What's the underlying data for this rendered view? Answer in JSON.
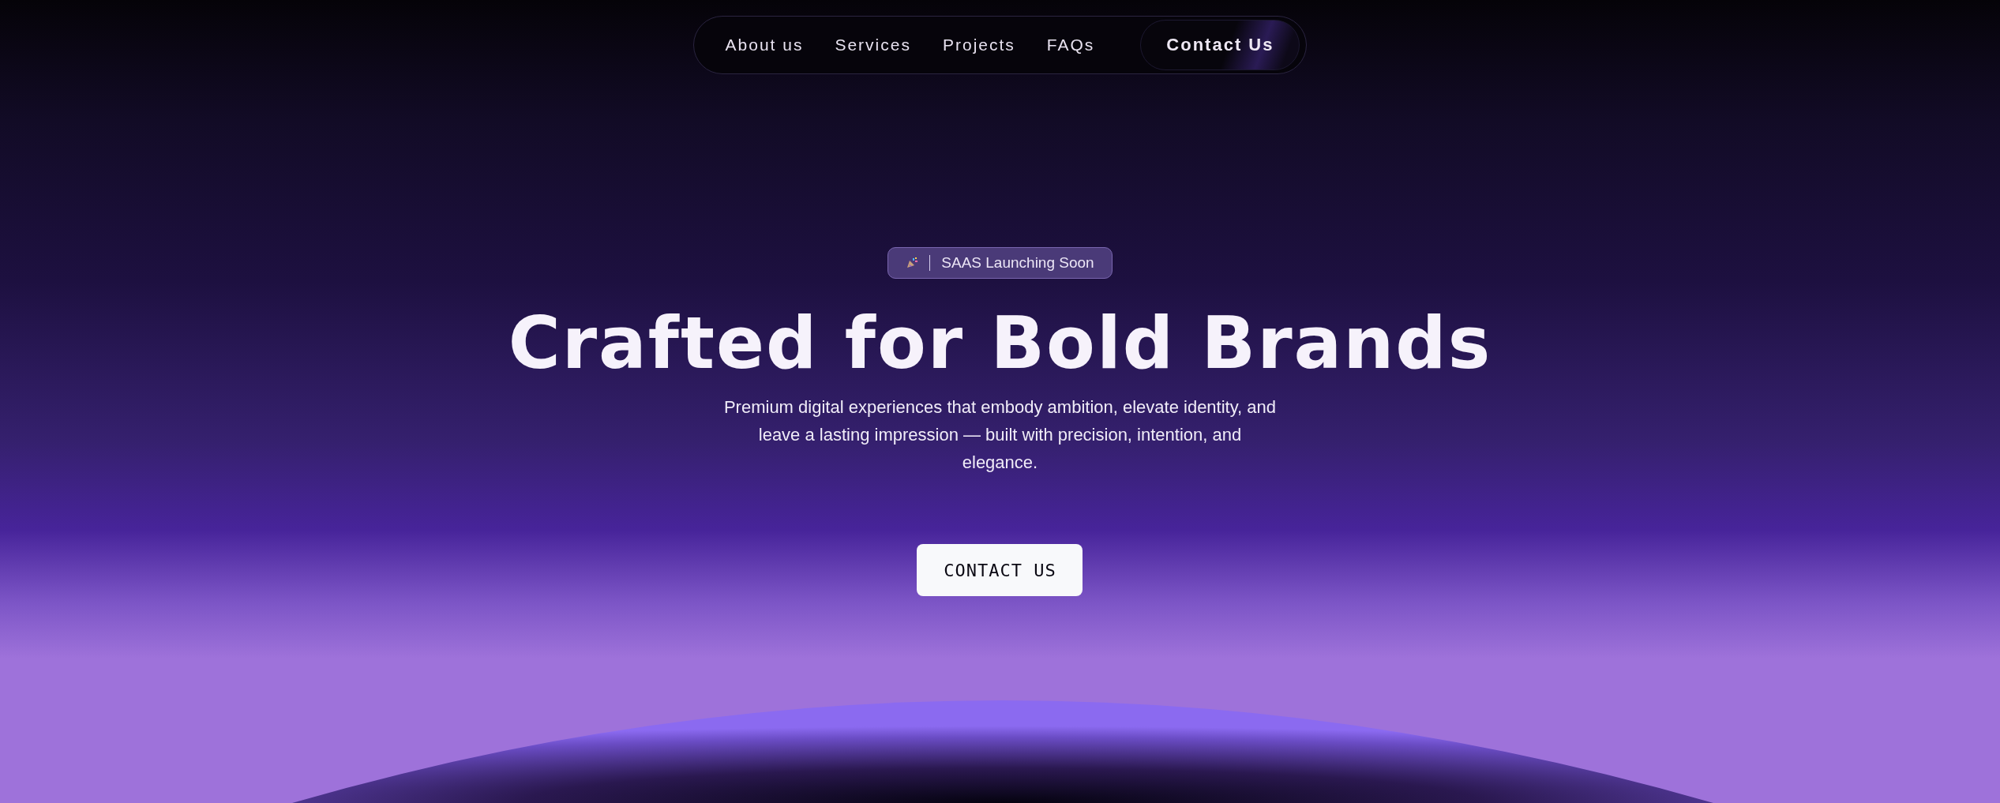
{
  "nav": {
    "links": [
      {
        "label": "About us"
      },
      {
        "label": "Services"
      },
      {
        "label": "Projects"
      },
      {
        "label": "FAQs"
      }
    ],
    "cta": "Contact Us"
  },
  "hero": {
    "badge": "SAAS Launching Soon",
    "title": "Crafted for Bold Brands",
    "subtitle": "Premium digital experiences that embody ambition, elevate identity, and leave a lasting impression — built with precision, intention, and elegance.",
    "button": "CONTACT US"
  }
}
